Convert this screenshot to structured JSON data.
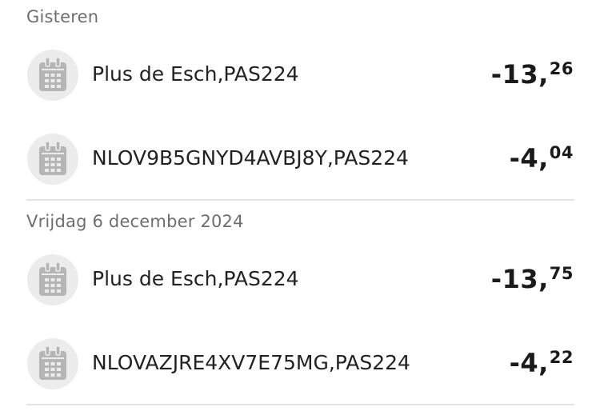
{
  "groups": [
    {
      "header": "Gisteren",
      "transactions": [
        {
          "merchant": "Plus de Esch,PAS224",
          "amount_int": "-13,",
          "amount_dec": "26",
          "icon": "calendar-icon"
        },
        {
          "merchant": "NLOV9B5GNYD4AVBJ8Y,PAS224",
          "amount_int": "-4,",
          "amount_dec": "04",
          "icon": "calendar-icon"
        }
      ]
    },
    {
      "header": "Vrijdag 6 december 2024",
      "transactions": [
        {
          "merchant": "Plus de Esch,PAS224",
          "amount_int": "-13,",
          "amount_dec": "75",
          "icon": "calendar-icon"
        },
        {
          "merchant": "NLOVAZJRE4XV7E75MG,PAS224",
          "amount_int": "-4,",
          "amount_dec": "22",
          "icon": "calendar-icon"
        }
      ]
    }
  ],
  "colors": {
    "header_text": "#6e6e6e",
    "icon_bg": "#ececec",
    "icon_fg": "#b5b5b5",
    "divider": "#e3e3e3"
  }
}
